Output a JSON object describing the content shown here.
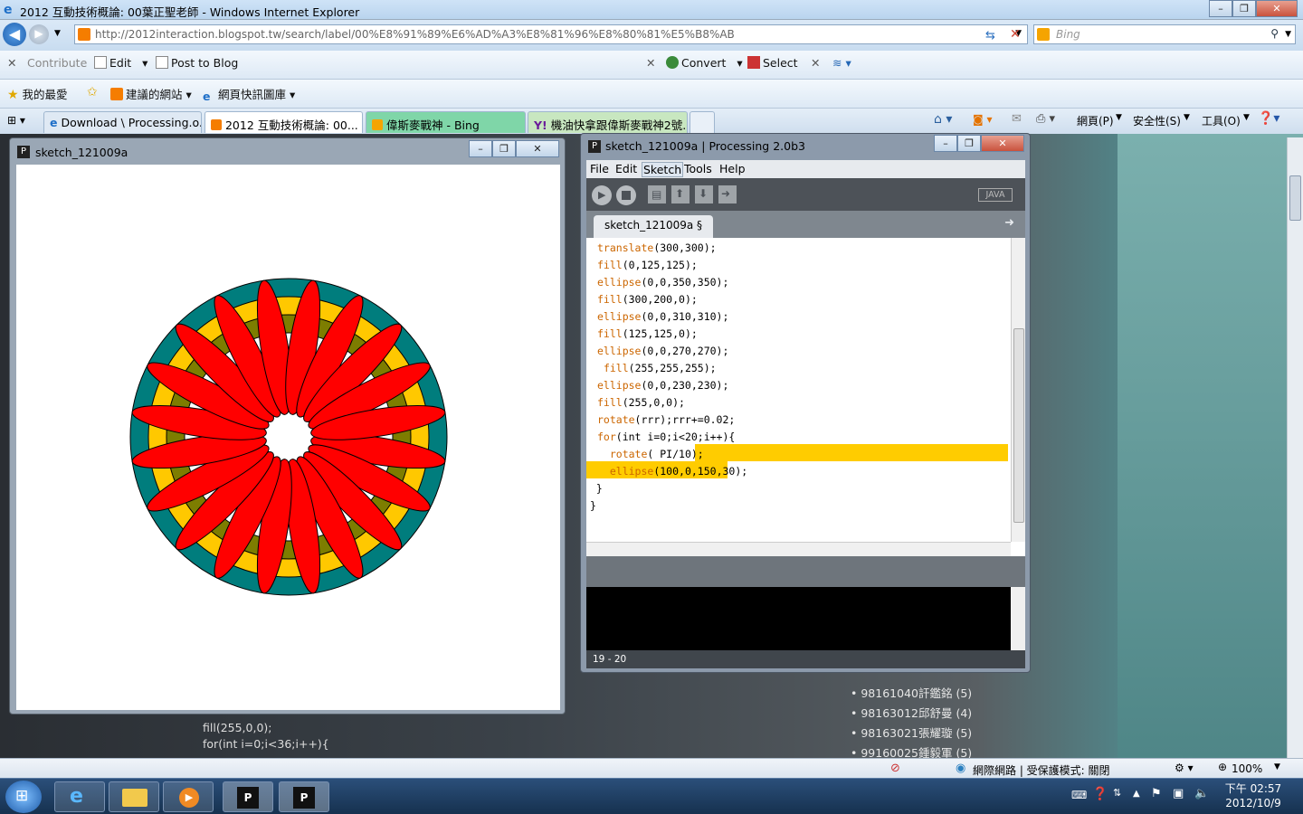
{
  "ie": {
    "title": "2012 互動技術概論: 00葉正聖老師 - Windows Internet Explorer",
    "url": "http://2012interaction.blogspot.tw/search/label/00%E8%91%89%E6%AD%A3%E8%81%96%E8%80%81%E5%B8%AB",
    "search_placeholder": "Bing",
    "zoom": "100%"
  },
  "toolbar1": {
    "contribute": "Contribute",
    "edit": "Edit",
    "post_to_blog": "Post to Blog",
    "convert": "Convert",
    "select": "Select"
  },
  "favbar": {
    "favorites": "我的最愛",
    "suggested": "建議的網站",
    "webslice": "網頁快訊圖庫"
  },
  "tabs": [
    {
      "label": "Download \\ Processing.o..."
    },
    {
      "label": "2012 互動技術概論: 00..."
    },
    {
      "label": "偉斯麥戰神 - Bing"
    },
    {
      "label": "機油快拿跟偉斯麥戰神2號..."
    }
  ],
  "cmdbar": {
    "page": "網頁(P)",
    "safety": "安全性(S)",
    "tools": "工具(O)"
  },
  "sketch": {
    "title": "sketch_121009a"
  },
  "ide": {
    "title": "sketch_121009a | Processing 2.0b3",
    "menu": [
      "File",
      "Edit",
      "Sketch",
      "Tools",
      "Help"
    ],
    "mode": "JAVA",
    "tab": "sketch_121009a §",
    "code": [
      "translate(300,300);",
      "fill(0,125,125);",
      "ellipse(0,0,350,350);",
      "fill(300,200,0);",
      "ellipse(0,0,310,310);",
      "fill(125,125,0);",
      "ellipse(0,0,270,270);",
      " fill(255,255,255);",
      "ellipse(0,0,230,230);",
      "fill(255,0,0);",
      "rotate(rrr);rrr+=0.02;",
      "for(int i=0;i<20;i++){",
      "  rotate( PI/10);",
      "  ellipse(100,0,150,30);",
      " }",
      "}"
    ],
    "line_status": "19 - 20"
  },
  "blog": {
    "code_snippet": [
      "fill(255,0,0);",
      "for(int i=0;i<36;i++){"
    ],
    "list": [
      "98161040訐鑑銘 (5)",
      "98163012邱舒曼 (4)",
      "98163021張耀璇 (5)",
      "99160025鍾毅軍 (5)"
    ]
  },
  "status": {
    "zone": "網際網路 | 受保護模式: 關閉"
  },
  "clock": {
    "time": "下午 02:57",
    "date": "2012/10/9"
  },
  "colors": {
    "teal": "#007d7d",
    "gold": "#ffc800",
    "olive": "#7d7d00",
    "red": "#ff0000",
    "highlight": "#ffcc00"
  }
}
